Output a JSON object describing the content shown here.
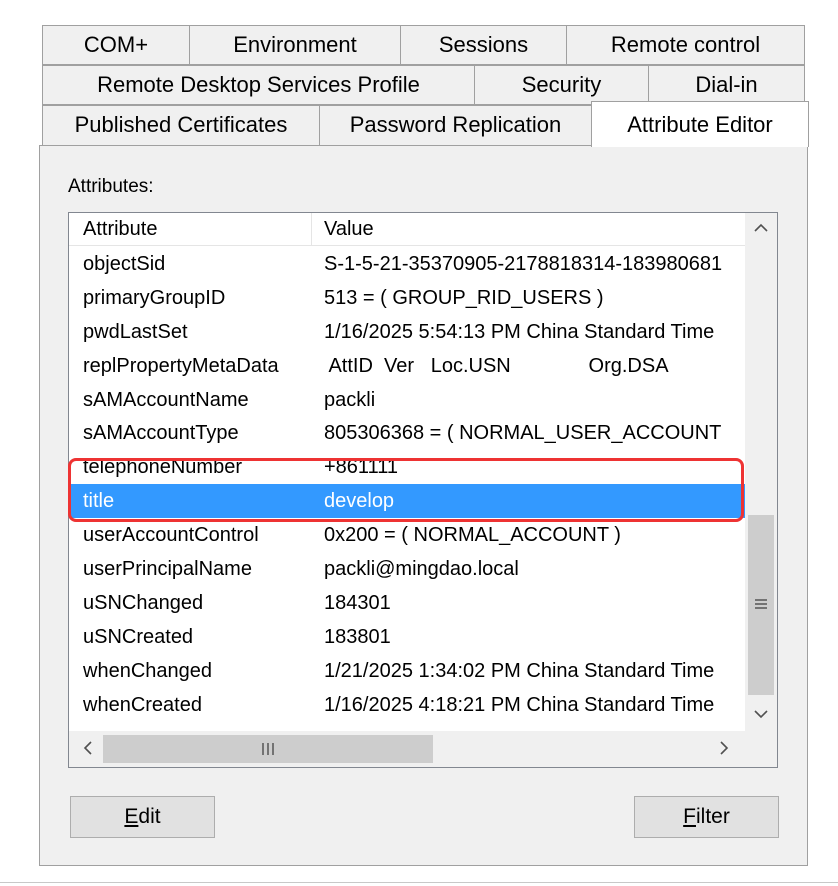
{
  "tabs": {
    "row1": [
      {
        "label": "COM+"
      },
      {
        "label": "Environment"
      },
      {
        "label": "Sessions"
      },
      {
        "label": "Remote control"
      }
    ],
    "row2": [
      {
        "label": "Remote Desktop Services Profile"
      },
      {
        "label": "Security"
      },
      {
        "label": "Dial-in"
      }
    ],
    "row3": [
      {
        "label": "Published Certificates"
      },
      {
        "label": "Password Replication"
      },
      {
        "label": "Attribute Editor",
        "active": true
      }
    ]
  },
  "attributes_label": "Attributes:",
  "list": {
    "columns": [
      "Attribute",
      "Value"
    ],
    "rows": [
      {
        "attribute": "objectSid",
        "value": "S-1-5-21-35370905-2178818314-183980681"
      },
      {
        "attribute": "primaryGroupID",
        "value": "513 = ( GROUP_RID_USERS )"
      },
      {
        "attribute": "pwdLastSet",
        "value": "1/16/2025 5:54:13 PM China Standard Time"
      },
      {
        "attribute": "replPropertyMetaData",
        "value": " AttID  Ver   Loc.USN              Org.DSA"
      },
      {
        "attribute": "sAMAccountName",
        "value": "packli"
      },
      {
        "attribute": "sAMAccountType",
        "value": "805306368 = ( NORMAL_USER_ACCOUNT"
      },
      {
        "attribute": "telephoneNumber",
        "value": "+861111"
      },
      {
        "attribute": "title",
        "value": "develop",
        "selected": true
      },
      {
        "attribute": "userAccountControl",
        "value": "0x200 = ( NORMAL_ACCOUNT )"
      },
      {
        "attribute": "userPrincipalName",
        "value": "packli@mingdao.local"
      },
      {
        "attribute": "uSNChanged",
        "value": "184301"
      },
      {
        "attribute": "uSNCreated",
        "value": "183801"
      },
      {
        "attribute": "whenChanged",
        "value": "1/21/2025 1:34:02 PM China Standard Time"
      },
      {
        "attribute": "whenCreated",
        "value": "1/16/2025 4:18:21 PM China Standard Time"
      }
    ]
  },
  "buttons": {
    "edit": "Edit",
    "filter": "Filter"
  },
  "icons": {
    "scroll_up": "chevron-up-icon",
    "scroll_down": "chevron-down-icon",
    "scroll_left": "chevron-left-icon",
    "scroll_right": "chevron-right-icon",
    "grip_vertical": "grip-lines-icon",
    "grip_horizontal": "grip-lines-icon"
  },
  "colors": {
    "selection": "#3399ff",
    "highlight_border": "#ee3333"
  }
}
